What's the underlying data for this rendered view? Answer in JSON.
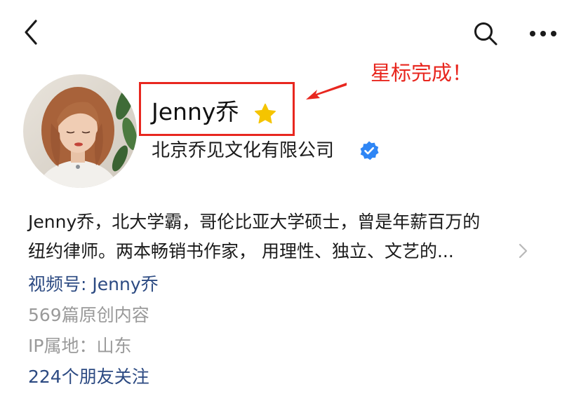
{
  "nav": {
    "back_icon": "chevron-left-icon",
    "search_icon": "search-icon",
    "more_icon": "more-horizontal-icon"
  },
  "profile": {
    "name": "Jenny乔",
    "star_icon": "star-icon",
    "star_color": "#f5c400",
    "company": "北京乔见文化有限公司",
    "verified_icon": "verified-badge-icon",
    "verified_color": "#2f86f5"
  },
  "annotation": {
    "text": "星标完成！",
    "color": "#e8271f"
  },
  "description": {
    "line1": "Jenny乔，北大学霸，哥伦比亚大学硕士，曾是年薪百万的",
    "line2": "纽约律师。两本畅销书作家， 用理性、独立、文艺的..."
  },
  "meta": {
    "channel": "视频号: Jenny乔",
    "articles": "569篇原创内容",
    "ip_location": "IP属地：山东",
    "friends_following": "224个朋友关注"
  },
  "colors": {
    "link_blue": "#2c4a82",
    "gray_text": "#9a9a9a"
  }
}
